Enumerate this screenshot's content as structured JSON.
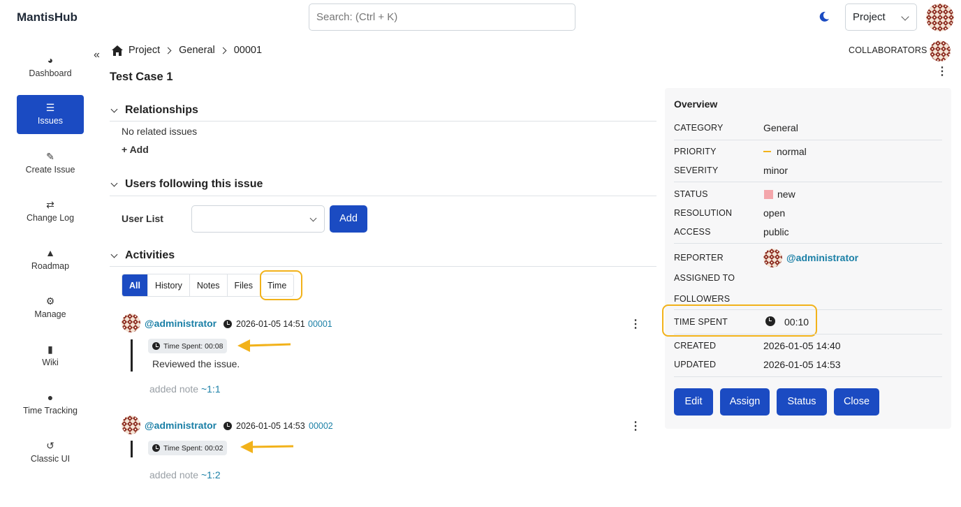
{
  "app": {
    "name": "MantisHub"
  },
  "topbar": {
    "search_placeholder": "Search: (Ctrl + K)",
    "project_select": "Project"
  },
  "sidebar": {
    "items": [
      {
        "label": "Dashboard",
        "icon": "dashboard-icon"
      },
      {
        "label": "Issues",
        "icon": "list-icon",
        "active": true
      },
      {
        "label": "Create Issue",
        "icon": "edit-icon"
      },
      {
        "label": "Change Log",
        "icon": "change-log-icon"
      },
      {
        "label": "Roadmap",
        "icon": "roadmap-icon"
      },
      {
        "label": "Manage",
        "icon": "gears-icon"
      },
      {
        "label": "Wiki",
        "icon": "file-icon"
      },
      {
        "label": "Time Tracking",
        "icon": "clock-icon"
      },
      {
        "label": "Classic UI",
        "icon": "history-icon"
      }
    ]
  },
  "breadcrumb": {
    "items": [
      "Project",
      "General",
      "00001"
    ]
  },
  "collaborators_label": "COLLABORATORS",
  "issue": {
    "title": "Test Case 1"
  },
  "relationships": {
    "heading": "Relationships",
    "empty_text": "No related issues",
    "add_label": "Add"
  },
  "followers_section": {
    "heading": "Users following this issue",
    "user_list_label": "User List",
    "select_value": "",
    "add_button": "Add"
  },
  "activities": {
    "heading": "Activities",
    "tabs": [
      "All",
      "History",
      "Notes",
      "Files",
      "Time"
    ],
    "active_tab": "All",
    "entries": [
      {
        "user": "@administrator",
        "timestamp": "2026-01-05 14:51",
        "id": "00001",
        "time_spent": "Time Spent: 00:08",
        "note": "Reviewed the issue.",
        "footer_prefix": "added note",
        "footer_link": "~1:1"
      },
      {
        "user": "@administrator",
        "timestamp": "2026-01-05 14:53",
        "id": "00002",
        "time_spent": "Time Spent: 00:02",
        "note": "",
        "footer_prefix": "added note",
        "footer_link": "~1:2"
      }
    ]
  },
  "overview": {
    "heading": "Overview",
    "category": {
      "label": "CATEGORY",
      "value": "General"
    },
    "priority": {
      "label": "PRIORITY",
      "value": "normal"
    },
    "severity": {
      "label": "SEVERITY",
      "value": "minor"
    },
    "status": {
      "label": "STATUS",
      "value": "new"
    },
    "resolution": {
      "label": "RESOLUTION",
      "value": "open"
    },
    "access": {
      "label": "ACCESS",
      "value": "public"
    },
    "reporter": {
      "label": "REPORTER",
      "value": "@administrator"
    },
    "assigned_to": {
      "label": "ASSIGNED TO",
      "value": ""
    },
    "followers": {
      "label": "FOLLOWERS",
      "value": ""
    },
    "time_spent": {
      "label": "TIME SPENT",
      "value": "00:10"
    },
    "created": {
      "label": "CREATED",
      "value": "2026-01-05 14:40"
    },
    "updated": {
      "label": "UPDATED",
      "value": "2026-01-05 14:53"
    },
    "buttons": [
      "Edit",
      "Assign",
      "Status",
      "Close"
    ]
  },
  "colors": {
    "primary": "#1b4bc2",
    "link": "#1a7fa6",
    "highlight": "#f2b21a",
    "status_new": "#f4a6ab"
  }
}
